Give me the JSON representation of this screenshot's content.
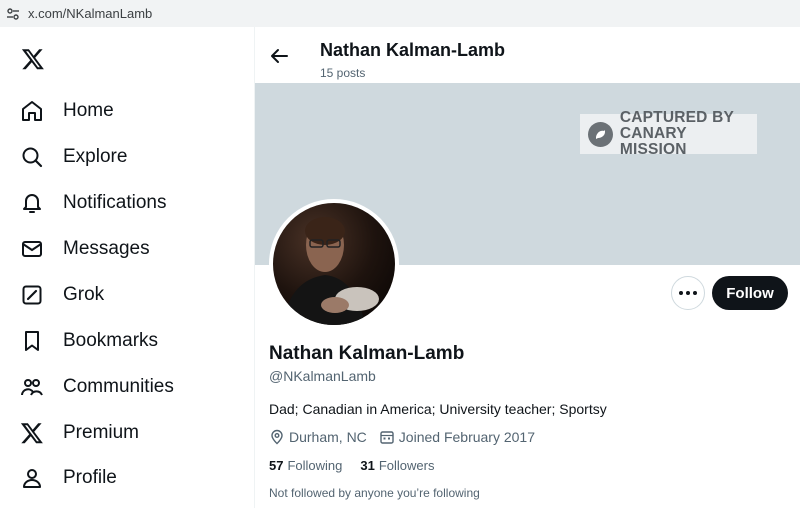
{
  "browser": {
    "url": "x.com/NKalmanLamb"
  },
  "sidebar": {
    "items": [
      {
        "label": "Home",
        "icon": "home-icon"
      },
      {
        "label": "Explore",
        "icon": "search-icon"
      },
      {
        "label": "Notifications",
        "icon": "bell-icon"
      },
      {
        "label": "Messages",
        "icon": "mail-icon"
      },
      {
        "label": "Grok",
        "icon": "grok-icon"
      },
      {
        "label": "Bookmarks",
        "icon": "bookmark-icon"
      },
      {
        "label": "Communities",
        "icon": "people-icon"
      },
      {
        "label": "Premium",
        "icon": "x-logo-icon"
      },
      {
        "label": "Profile",
        "icon": "person-icon"
      }
    ]
  },
  "header": {
    "title": "Nathan Kalman-Lamb",
    "posts": "15 posts"
  },
  "banner": {
    "stamp_line1": "CAPTURED BY",
    "stamp_line2": "CANARY MISSION"
  },
  "profile": {
    "name": "Nathan Kalman-Lamb",
    "handle": "@NKalmanLamb",
    "bio": "Dad; Canadian in America; University teacher; Sportsy",
    "location": "Durham, NC",
    "joined": "Joined February 2017",
    "following_count": "57",
    "following_label": "Following",
    "followers_count": "31",
    "followers_label": "Followers",
    "not_followed": "Not followed by anyone you’re following"
  },
  "actions": {
    "follow_label": "Follow"
  },
  "colors": {
    "text": "#0f1419",
    "muted": "#536471",
    "banner": "#cfd9de",
    "follow_bg": "#0f1419"
  }
}
